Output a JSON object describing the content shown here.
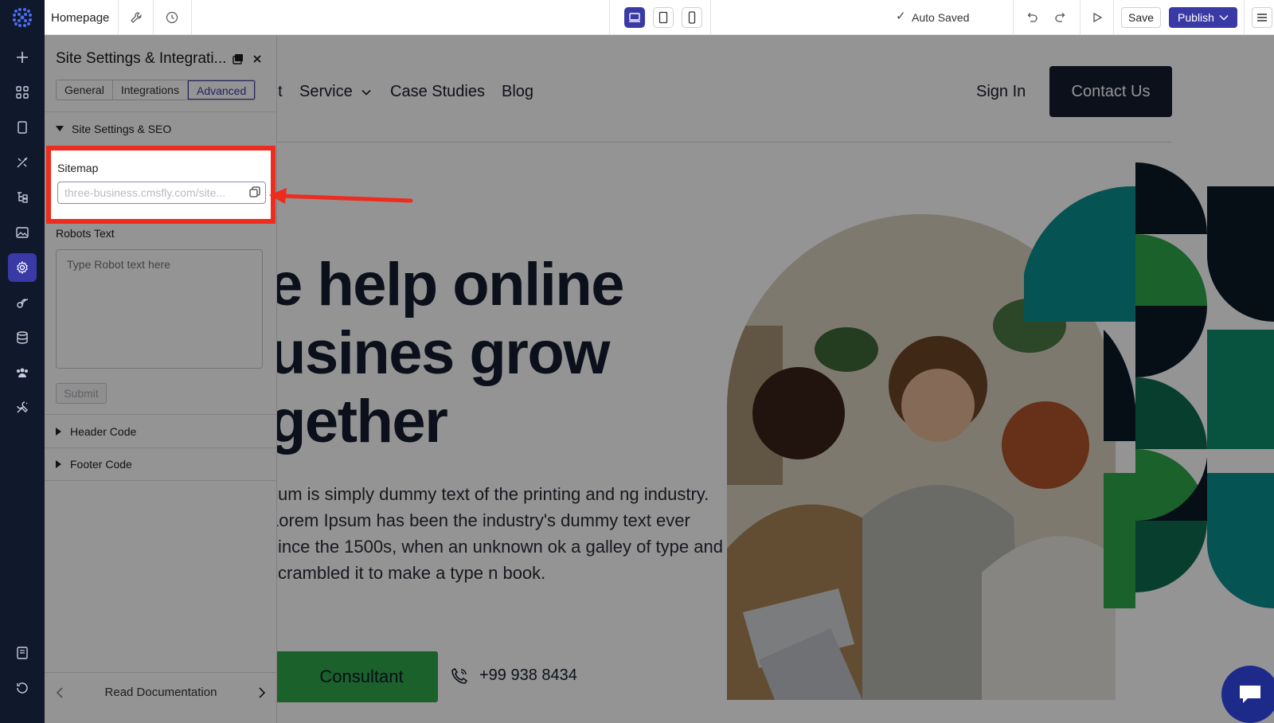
{
  "topbar": {
    "page_name": "Homepage",
    "auto_saved": "Auto Saved",
    "save": "Save",
    "publish": "Publish"
  },
  "website": {
    "nav": [
      "ut",
      "Service",
      "Case Studies",
      "Blog"
    ],
    "sign_in": "Sign In",
    "contact": "Contact Us",
    "hero_lines": [
      "e help online",
      "usines grow",
      "gether"
    ],
    "paragraph": "sum is simply dummy text of the printing and ng industry. Lorem Ipsum has been the industry's dummy text ever since the 1500s, when an unknown ok a galley of type and scrambled it to make a type n book.",
    "consult_btn": "Consultant",
    "phone": "+99 938 8434"
  },
  "panel": {
    "title": "Site Settings & Integrati...",
    "tabs": [
      "General",
      "Integrations",
      "Advanced"
    ],
    "active_tab": "Advanced",
    "section_seo": "Site Settings & SEO",
    "sitemap_label": "Sitemap",
    "sitemap_value": "three-business.cmsfly.com/site...",
    "robots_label": "Robots Text",
    "robots_placeholder": "Type Robot text here",
    "submit": "Submit",
    "header_code": "Header Code",
    "footer_code": "Footer Code",
    "read_docs": "Read Documentation"
  },
  "colors": {
    "accent": "#3a3aa6",
    "rail_bg": "#10182c",
    "highlight": "#ee2b1f",
    "cta_green": "#2ea84a"
  }
}
